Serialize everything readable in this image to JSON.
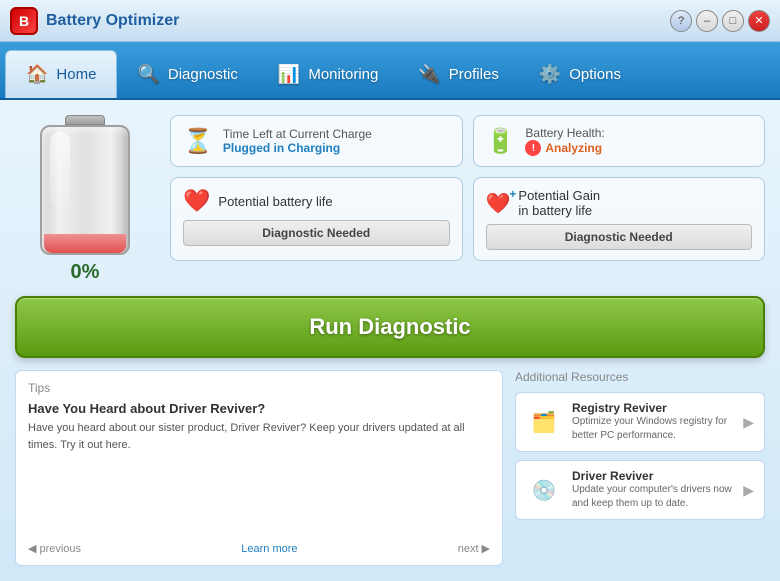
{
  "window": {
    "title": "Battery Optimizer",
    "logo_letter": "B"
  },
  "title_controls": {
    "help": "?",
    "minimize": "–",
    "maximize": "□",
    "close": "✕"
  },
  "nav": {
    "tabs": [
      {
        "id": "home",
        "label": "Home",
        "icon": "🏠",
        "active": true
      },
      {
        "id": "diagnostic",
        "label": "Diagnostic",
        "icon": "🔍",
        "active": false
      },
      {
        "id": "monitoring",
        "label": "Monitoring",
        "icon": "📊",
        "active": false
      },
      {
        "id": "profiles",
        "label": "Profiles",
        "icon": "🔌",
        "active": false
      },
      {
        "id": "options",
        "label": "Options",
        "icon": "⚙️",
        "active": false
      }
    ]
  },
  "battery": {
    "percent": "0%",
    "fill_height": "15%"
  },
  "info_cards": {
    "time_left": {
      "label": "Time Left at Current Charge",
      "value": "Plugged in Charging"
    },
    "battery_health": {
      "label": "Battery Health:",
      "value": "Analyzing"
    }
  },
  "potential": {
    "left": {
      "title": "Potential battery life",
      "button_label": "Diagnostic Needed"
    },
    "right": {
      "title": "Potential Gain\nin battery life",
      "button_label": "Diagnostic Needed"
    }
  },
  "run_diagnostic": {
    "label": "Run Diagnostic"
  },
  "tips": {
    "section_title": "Tips",
    "headline": "Have You Heard about Driver Reviver?",
    "body": "Have you heard about our sister product, Driver Reviver? Keep your drivers updated at all times. Try it out here.",
    "previous_label": "previous",
    "learn_more_label": "Learn more",
    "next_label": "next"
  },
  "resources": {
    "section_title": "Additional Resources",
    "items": [
      {
        "name": "Registry Reviver",
        "desc": "Optimize your Windows registry for better PC performance.",
        "icon": "🗂️"
      },
      {
        "name": "Driver Reviver",
        "desc": "Update your computer's drivers now and keep them up to date.",
        "icon": "💿"
      }
    ]
  }
}
